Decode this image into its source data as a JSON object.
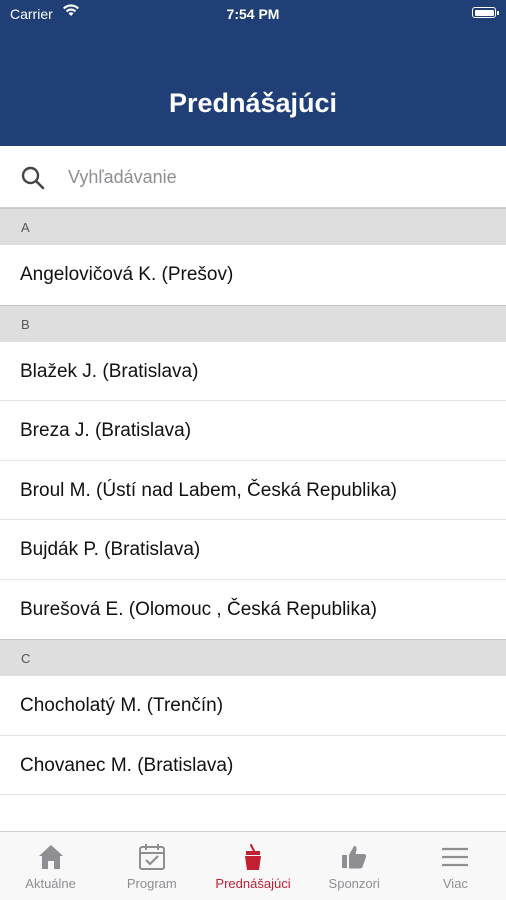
{
  "status_bar": {
    "carrier": "Carrier",
    "time": "7:54 PM"
  },
  "header": {
    "title": "Prednášajúci",
    "background_color": "#1f3f76"
  },
  "search": {
    "placeholder": "Vyhľadávanie",
    "value": "",
    "icon": "search-icon"
  },
  "speakers": {
    "section_a": {
      "letter": "A",
      "items": [
        "Angelovičová K. (Prešov)"
      ]
    },
    "section_b": {
      "letter": "B",
      "items": [
        "Blažek J. (Bratislava)",
        "Breza J. (Bratislava)",
        "Broul M. (Ústí nad Labem, Česká Republika)",
        "Bujdák P. (Bratislava)",
        "Burešová E. (Olomouc , Česká Republika)"
      ]
    },
    "section_c": {
      "letter": "C",
      "items": [
        "Chocholatý M. (Trenčín)",
        "Chovanec M. (Bratislava)"
      ]
    }
  },
  "tab_bar": {
    "active_color": "#c21f32",
    "inactive_color": "#8e8e93",
    "tabs": [
      {
        "label": "Aktuálne",
        "icon": "home-icon",
        "active": false
      },
      {
        "label": "Program",
        "icon": "calendar-icon",
        "active": false
      },
      {
        "label": "Prednášajúci",
        "icon": "podium-icon",
        "active": true
      },
      {
        "label": "Sponzori",
        "icon": "thumbs-up-icon",
        "active": false
      },
      {
        "label": "Viac",
        "icon": "menu-icon",
        "active": false
      }
    ]
  }
}
